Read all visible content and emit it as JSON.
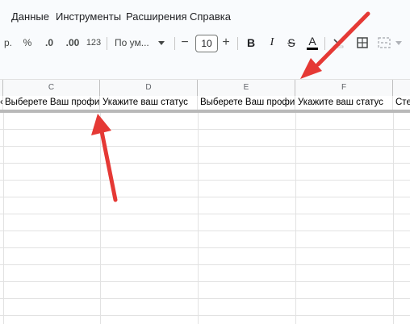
{
  "menu": {
    "items": [
      "Данные",
      "Инструменты",
      "Расширения",
      "Справка"
    ]
  },
  "toolbar": {
    "currency_partial": "р.",
    "percent": "%",
    "decrease_decimals": ".0",
    "increase_decimals": ".00",
    "more_formats": "123",
    "font_family": "По ум...",
    "font_size": "10",
    "minus": "−",
    "plus": "+",
    "bold": "B",
    "italic": "I",
    "strikethrough": "S",
    "text_color": "A"
  },
  "columns": [
    "C",
    "D",
    "E",
    "F"
  ],
  "row1": {
    "b_partial": "«",
    "c": "Выберете Ваш профиль",
    "d": "Укажите ваш статус",
    "e": "Выберете Ваш профиль",
    "f": "Укажите ваш статус",
    "g_partial": "Сте"
  },
  "colors": {
    "accent_arrow": "#e53935",
    "freeze_bar": "#b9b9b9",
    "header_bg": "#f8f9fa"
  }
}
